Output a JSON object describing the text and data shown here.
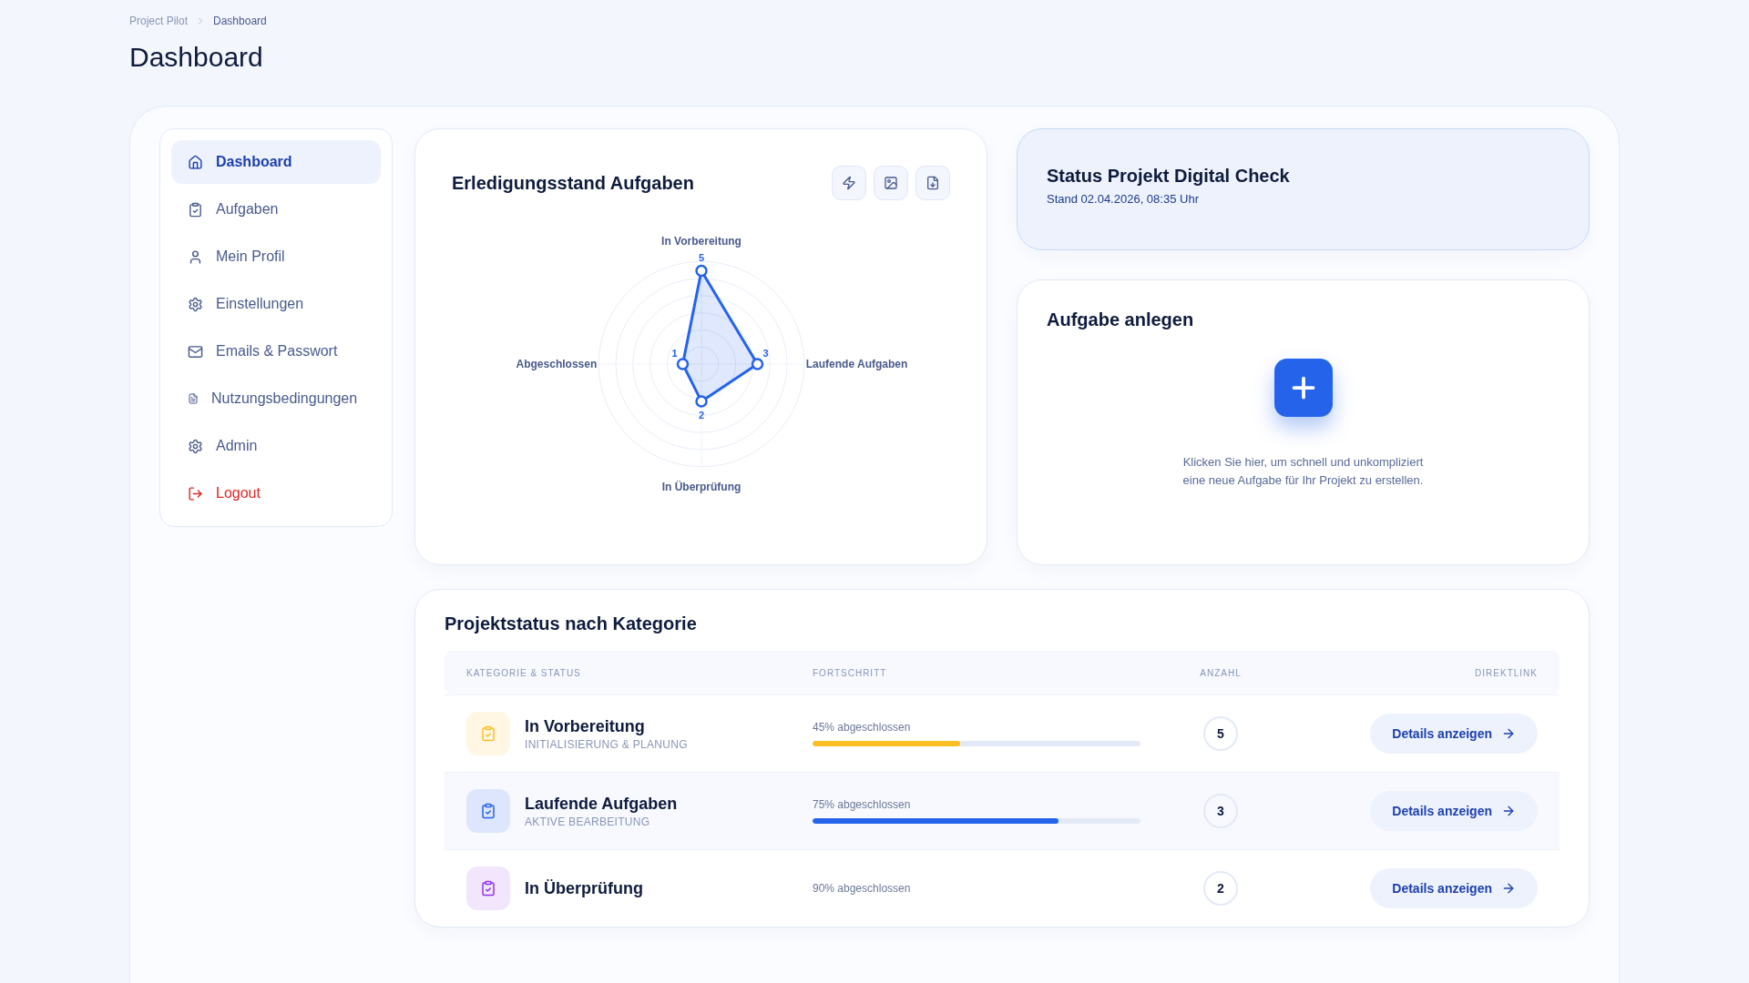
{
  "breadcrumb": [
    "Project Pilot",
    "Dashboard"
  ],
  "page_title": "Dashboard",
  "sidebar": {
    "items": [
      {
        "label": "Dashboard",
        "selected": true,
        "kind": "nav"
      },
      {
        "label": "Aufgaben",
        "selected": false,
        "kind": "nav"
      },
      {
        "label": "Mein Profil",
        "selected": false,
        "kind": "nav"
      },
      {
        "label": "Einstellungen",
        "selected": false,
        "kind": "nav"
      },
      {
        "label": "Emails & Passwort",
        "selected": false,
        "kind": "nav"
      },
      {
        "label": "Nutzungsbedingungen",
        "selected": false,
        "kind": "nav"
      },
      {
        "label": "Admin",
        "selected": false,
        "kind": "nav"
      },
      {
        "label": "Logout",
        "selected": false,
        "kind": "logout"
      }
    ]
  },
  "chart_card": {
    "title": "Erledigungsstand Aufgaben",
    "radar": [
      {
        "label": "In Vorbereitung",
        "value": "5"
      },
      {
        "label": "Laufende Aufgaben",
        "value": "3"
      },
      {
        "label": "In Überprüfung",
        "value": "2"
      },
      {
        "label": "Abgeschlossen",
        "value": "1"
      }
    ]
  },
  "status_card": {
    "title": "Status Projekt Digital Check",
    "subtitle": "Stand 02.04.2026, 08:35 Uhr"
  },
  "create_card": {
    "title": "Aufgabe anlegen",
    "description": "Klicken Sie hier, um schnell und unkompliziert eine neue Aufgabe für Ihr Projekt zu erstellen."
  },
  "table": {
    "title": "Projektstatus nach Kategorie",
    "columns": [
      "KATEGORIE & STATUS",
      "FORTSCHRITT",
      "ANZAHL",
      "DIREKTLINK"
    ],
    "rows": [
      {
        "name": "In Vorbereitung",
        "subtitle": "INITIALISIERUNG & PLANUNG",
        "progress": "45% abgeschlossen",
        "level": 0.45,
        "count": "5",
        "link": "Details anzeigen",
        "color": "#fbbf24"
      },
      {
        "name": "Laufende Aufgaben",
        "subtitle": "AKTIVE BEARBEITUNG",
        "progress": "75% abgeschlossen",
        "level": 0.75,
        "count": "3",
        "link": "Details anzeigen",
        "color": "#2563eb"
      },
      {
        "name": "In Überprüfung",
        "progress": "90% abgeschlossen",
        "count": "2",
        "link": "Details anzeigen",
        "color": "#9333ea"
      }
    ]
  }
}
